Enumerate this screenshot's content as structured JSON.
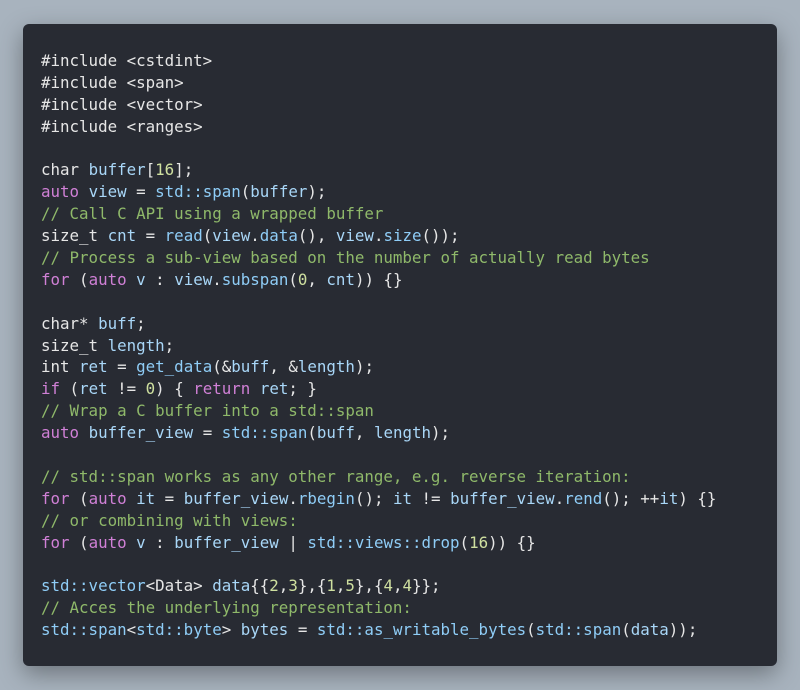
{
  "editor": {
    "colors": {
      "background": "#282b33",
      "page_background": "#a8b3be",
      "default": "#e6e6e6",
      "keyword": "#d080d6",
      "function": "#8fcdf7",
      "number": "#cfe0a0",
      "comment": "#8fb96a",
      "variable": "#a9d7f8"
    },
    "lines": [
      [
        {
          "t": "default",
          "s": "#include <cstdint>"
        }
      ],
      [
        {
          "t": "default",
          "s": "#include <span>"
        }
      ],
      [
        {
          "t": "default",
          "s": "#include <vector>"
        }
      ],
      [
        {
          "t": "default",
          "s": "#include <ranges>"
        }
      ],
      [],
      [
        {
          "t": "default",
          "s": "char "
        },
        {
          "t": "variable",
          "s": "buffer"
        },
        {
          "t": "default",
          "s": "["
        },
        {
          "t": "number",
          "s": "16"
        },
        {
          "t": "default",
          "s": "];"
        }
      ],
      [
        {
          "t": "keyword",
          "s": "auto"
        },
        {
          "t": "default",
          "s": " "
        },
        {
          "t": "variable",
          "s": "view"
        },
        {
          "t": "default",
          "s": " = "
        },
        {
          "t": "function",
          "s": "std::span"
        },
        {
          "t": "default",
          "s": "("
        },
        {
          "t": "variable",
          "s": "buffer"
        },
        {
          "t": "default",
          "s": ");"
        }
      ],
      [
        {
          "t": "comment",
          "s": "// Call C API using a wrapped buffer"
        }
      ],
      [
        {
          "t": "default",
          "s": "size_t "
        },
        {
          "t": "variable",
          "s": "cnt"
        },
        {
          "t": "default",
          "s": " = "
        },
        {
          "t": "function",
          "s": "read"
        },
        {
          "t": "default",
          "s": "("
        },
        {
          "t": "variable",
          "s": "view"
        },
        {
          "t": "default",
          "s": "."
        },
        {
          "t": "function",
          "s": "data"
        },
        {
          "t": "default",
          "s": "(), "
        },
        {
          "t": "variable",
          "s": "view"
        },
        {
          "t": "default",
          "s": "."
        },
        {
          "t": "function",
          "s": "size"
        },
        {
          "t": "default",
          "s": "());"
        }
      ],
      [
        {
          "t": "comment",
          "s": "// Process a sub-view based on the number of actually read bytes"
        }
      ],
      [
        {
          "t": "keyword",
          "s": "for"
        },
        {
          "t": "default",
          "s": " ("
        },
        {
          "t": "keyword",
          "s": "auto"
        },
        {
          "t": "default",
          "s": " "
        },
        {
          "t": "variable",
          "s": "v"
        },
        {
          "t": "default",
          "s": " : "
        },
        {
          "t": "variable",
          "s": "view"
        },
        {
          "t": "default",
          "s": "."
        },
        {
          "t": "function",
          "s": "subspan"
        },
        {
          "t": "default",
          "s": "("
        },
        {
          "t": "number",
          "s": "0"
        },
        {
          "t": "default",
          "s": ", "
        },
        {
          "t": "variable",
          "s": "cnt"
        },
        {
          "t": "default",
          "s": ")) {}"
        }
      ],
      [],
      [
        {
          "t": "default",
          "s": "char* "
        },
        {
          "t": "variable",
          "s": "buff"
        },
        {
          "t": "default",
          "s": ";"
        }
      ],
      [
        {
          "t": "default",
          "s": "size_t "
        },
        {
          "t": "variable",
          "s": "length"
        },
        {
          "t": "default",
          "s": ";"
        }
      ],
      [
        {
          "t": "default",
          "s": "int "
        },
        {
          "t": "variable",
          "s": "ret"
        },
        {
          "t": "default",
          "s": " = "
        },
        {
          "t": "function",
          "s": "get_data"
        },
        {
          "t": "default",
          "s": "(&"
        },
        {
          "t": "variable",
          "s": "buff"
        },
        {
          "t": "default",
          "s": ", &"
        },
        {
          "t": "variable",
          "s": "length"
        },
        {
          "t": "default",
          "s": ");"
        }
      ],
      [
        {
          "t": "keyword",
          "s": "if"
        },
        {
          "t": "default",
          "s": " ("
        },
        {
          "t": "variable",
          "s": "ret"
        },
        {
          "t": "default",
          "s": " != "
        },
        {
          "t": "number",
          "s": "0"
        },
        {
          "t": "default",
          "s": ") { "
        },
        {
          "t": "keyword",
          "s": "return"
        },
        {
          "t": "default",
          "s": " "
        },
        {
          "t": "variable",
          "s": "ret"
        },
        {
          "t": "default",
          "s": "; }"
        }
      ],
      [
        {
          "t": "comment",
          "s": "// Wrap a C buffer into a std::span"
        }
      ],
      [
        {
          "t": "keyword",
          "s": "auto"
        },
        {
          "t": "default",
          "s": " "
        },
        {
          "t": "variable",
          "s": "buffer_view"
        },
        {
          "t": "default",
          "s": " = "
        },
        {
          "t": "function",
          "s": "std::span"
        },
        {
          "t": "default",
          "s": "("
        },
        {
          "t": "variable",
          "s": "buff"
        },
        {
          "t": "default",
          "s": ", "
        },
        {
          "t": "variable",
          "s": "length"
        },
        {
          "t": "default",
          "s": ");"
        }
      ],
      [],
      [
        {
          "t": "comment",
          "s": "// std::span works as any other range, e.g. reverse iteration:"
        }
      ],
      [
        {
          "t": "keyword",
          "s": "for"
        },
        {
          "t": "default",
          "s": " ("
        },
        {
          "t": "keyword",
          "s": "auto"
        },
        {
          "t": "default",
          "s": " "
        },
        {
          "t": "variable",
          "s": "it"
        },
        {
          "t": "default",
          "s": " = "
        },
        {
          "t": "variable",
          "s": "buffer_view"
        },
        {
          "t": "default",
          "s": "."
        },
        {
          "t": "function",
          "s": "rbegin"
        },
        {
          "t": "default",
          "s": "(); "
        },
        {
          "t": "variable",
          "s": "it"
        },
        {
          "t": "default",
          "s": " != "
        },
        {
          "t": "variable",
          "s": "buffer_view"
        },
        {
          "t": "default",
          "s": "."
        },
        {
          "t": "function",
          "s": "rend"
        },
        {
          "t": "default",
          "s": "(); ++"
        },
        {
          "t": "variable",
          "s": "it"
        },
        {
          "t": "default",
          "s": ") {}"
        }
      ],
      [
        {
          "t": "comment",
          "s": "// or combining with views:"
        }
      ],
      [
        {
          "t": "keyword",
          "s": "for"
        },
        {
          "t": "default",
          "s": " ("
        },
        {
          "t": "keyword",
          "s": "auto"
        },
        {
          "t": "default",
          "s": " "
        },
        {
          "t": "variable",
          "s": "v"
        },
        {
          "t": "default",
          "s": " : "
        },
        {
          "t": "variable",
          "s": "buffer_view"
        },
        {
          "t": "default",
          "s": " | "
        },
        {
          "t": "function",
          "s": "std::views::drop"
        },
        {
          "t": "default",
          "s": "("
        },
        {
          "t": "number",
          "s": "16"
        },
        {
          "t": "default",
          "s": ")) {}"
        }
      ],
      [],
      [
        {
          "t": "function",
          "s": "std::vector"
        },
        {
          "t": "default",
          "s": "<Data> "
        },
        {
          "t": "variable",
          "s": "data"
        },
        {
          "t": "default",
          "s": "{{"
        },
        {
          "t": "number",
          "s": "2"
        },
        {
          "t": "default",
          "s": ","
        },
        {
          "t": "number",
          "s": "3"
        },
        {
          "t": "default",
          "s": "},{"
        },
        {
          "t": "number",
          "s": "1"
        },
        {
          "t": "default",
          "s": ","
        },
        {
          "t": "number",
          "s": "5"
        },
        {
          "t": "default",
          "s": "},{"
        },
        {
          "t": "number",
          "s": "4"
        },
        {
          "t": "default",
          "s": ","
        },
        {
          "t": "number",
          "s": "4"
        },
        {
          "t": "default",
          "s": "}};"
        }
      ],
      [
        {
          "t": "comment",
          "s": "// Acces the underlying representation:"
        }
      ],
      [
        {
          "t": "function",
          "s": "std::span"
        },
        {
          "t": "default",
          "s": "<"
        },
        {
          "t": "function",
          "s": "std::byte"
        },
        {
          "t": "default",
          "s": "> "
        },
        {
          "t": "variable",
          "s": "bytes"
        },
        {
          "t": "default",
          "s": " = "
        },
        {
          "t": "function",
          "s": "std::as_writable_bytes"
        },
        {
          "t": "default",
          "s": "("
        },
        {
          "t": "function",
          "s": "std::span"
        },
        {
          "t": "default",
          "s": "("
        },
        {
          "t": "variable",
          "s": "data"
        },
        {
          "t": "default",
          "s": "));"
        }
      ]
    ]
  }
}
